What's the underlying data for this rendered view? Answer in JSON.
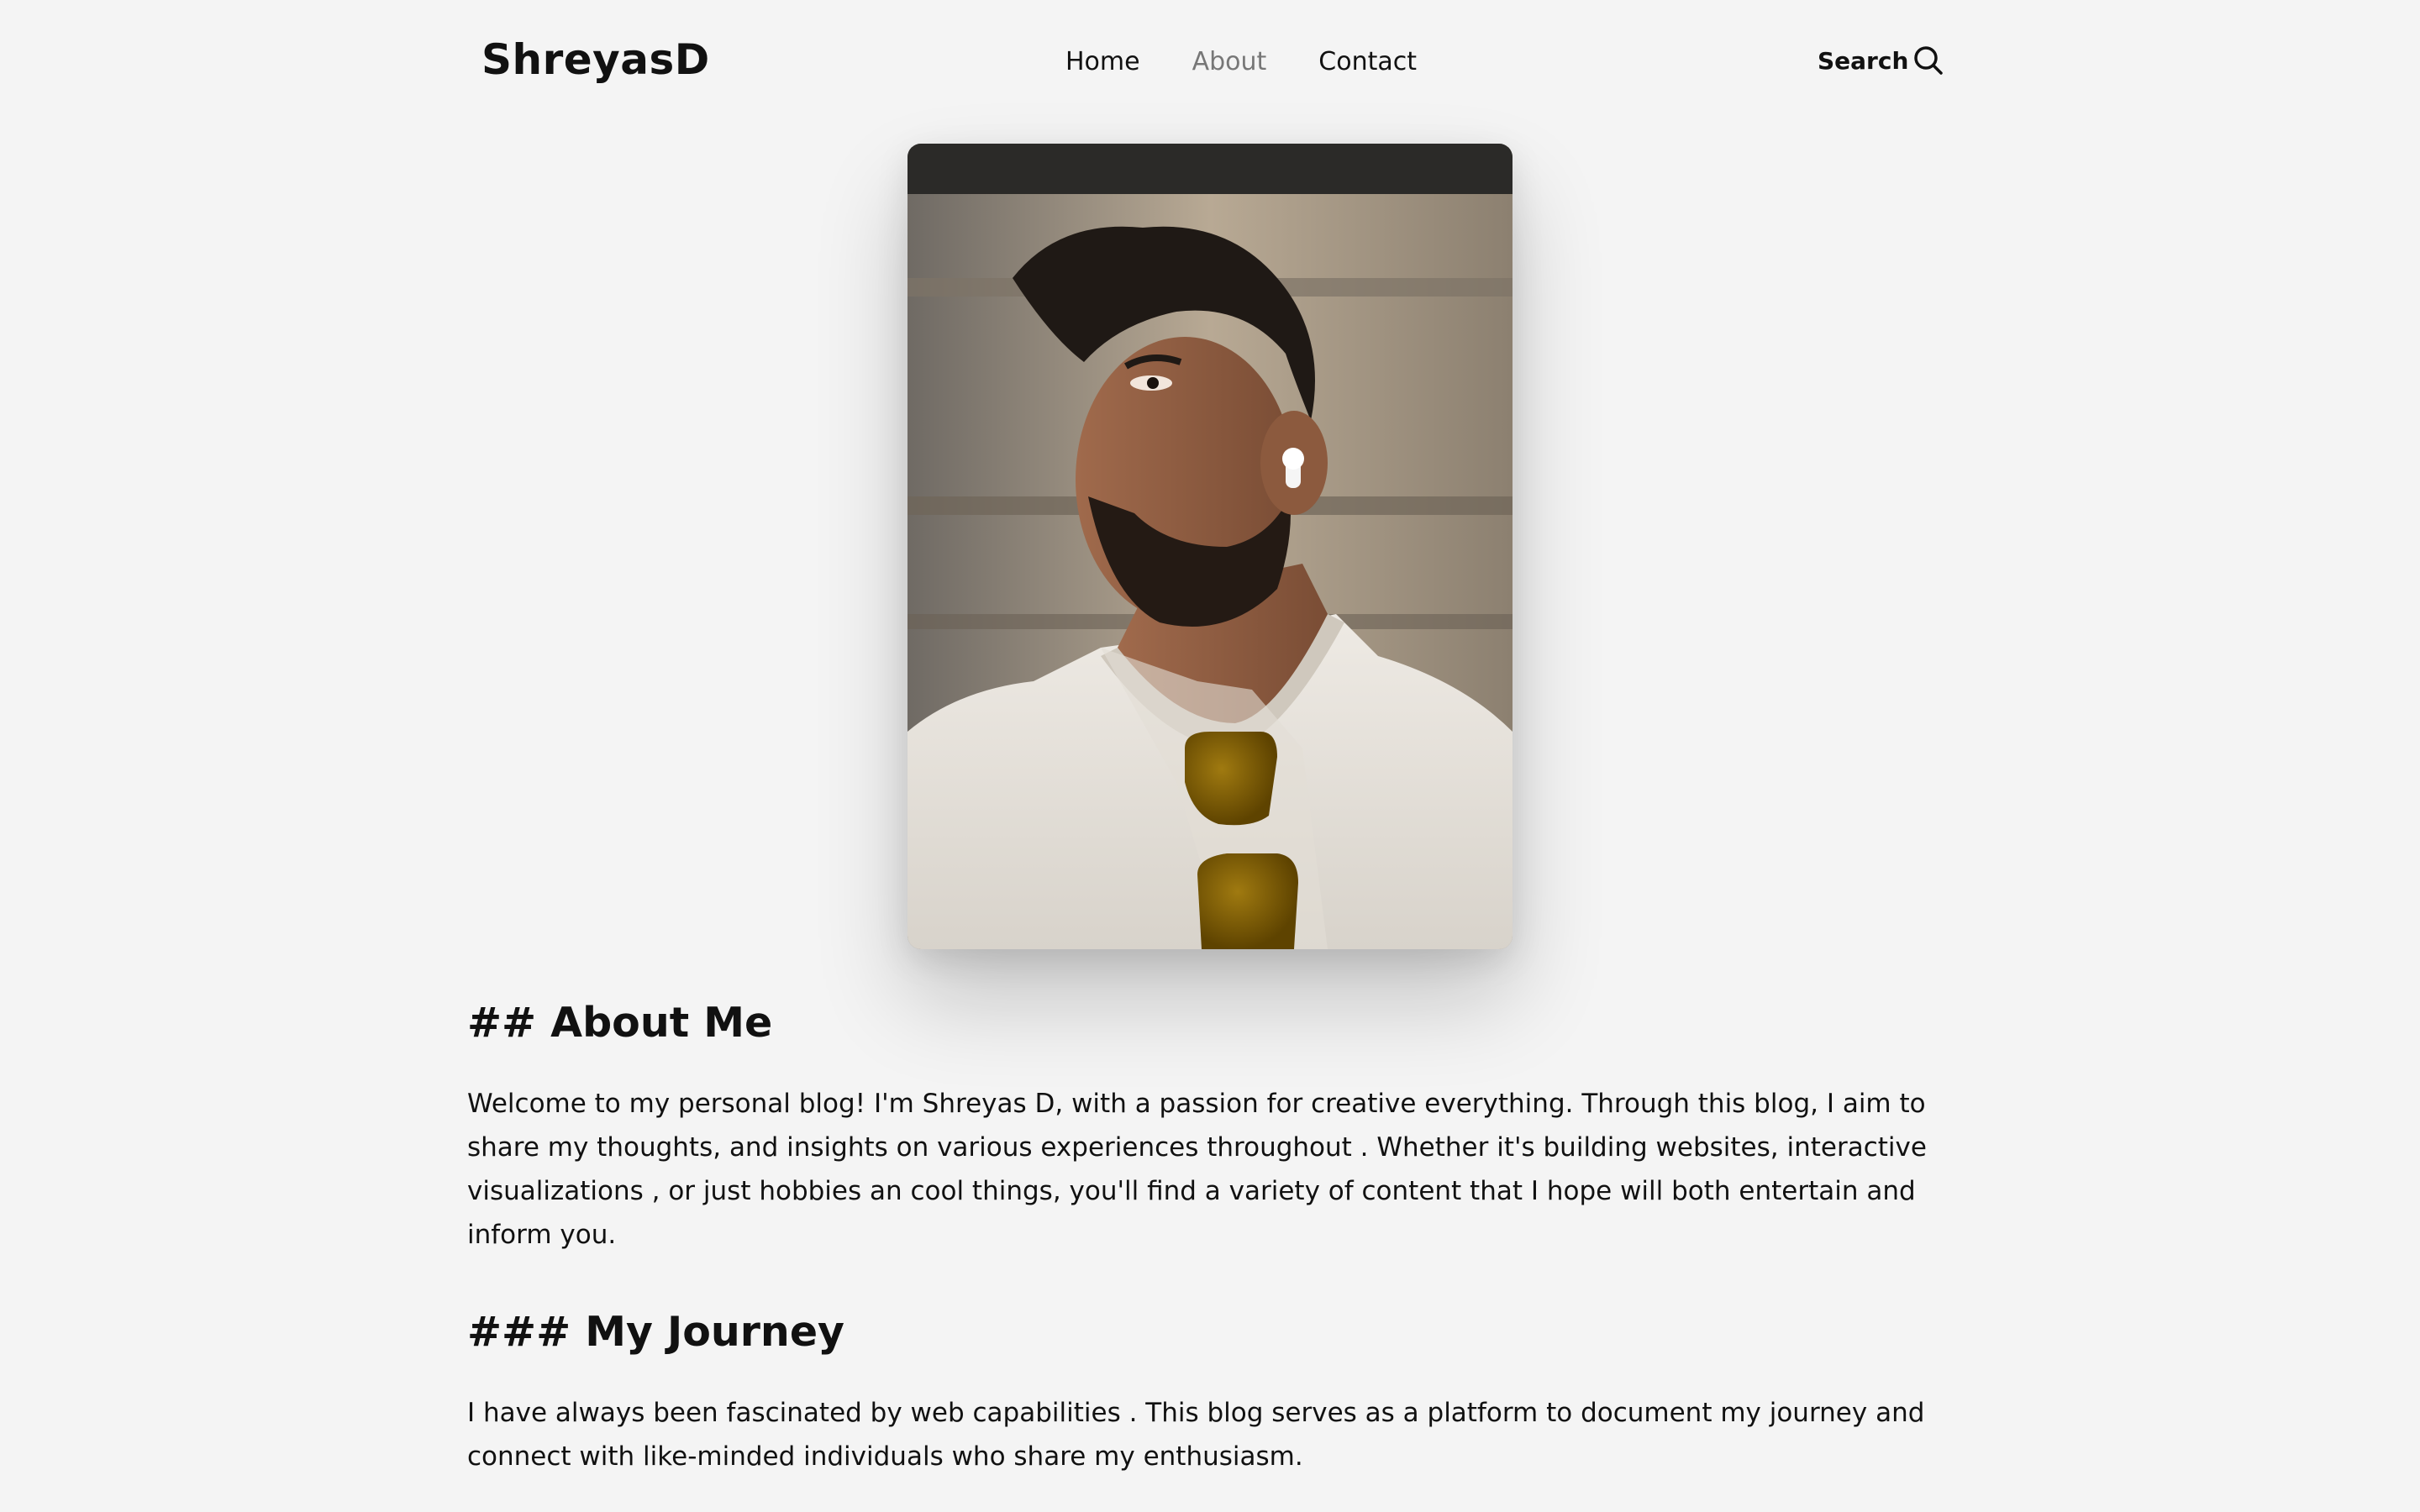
{
  "header": {
    "logo": "ShreyasD",
    "nav": [
      {
        "label": "Home",
        "active": false
      },
      {
        "label": "About",
        "active": true
      },
      {
        "label": "Contact",
        "active": false
      }
    ],
    "search_label": "Search",
    "search_icon": "search-icon"
  },
  "hero": {
    "image": "portrait-photo"
  },
  "sections": [
    {
      "heading": "## About Me",
      "body": "Welcome to my personal blog! I'm Shreyas D, with a passion for creative everything. Through this blog, I aim to share my thoughts, and insights on various experiences throughout . Whether it's building websites, interactive visualizations , or just hobbies an cool things, you'll find a variety of content that I hope will both entertain and inform you."
    },
    {
      "heading": "### My Journey",
      "body": "I have always been fascinated by web capabilities . This blog serves as a platform to document my journey and connect with like-minded individuals who share my enthusiasm."
    }
  ],
  "colors": {
    "background": "#f4f4f4",
    "text": "#111111",
    "nav_active": "#777777"
  }
}
